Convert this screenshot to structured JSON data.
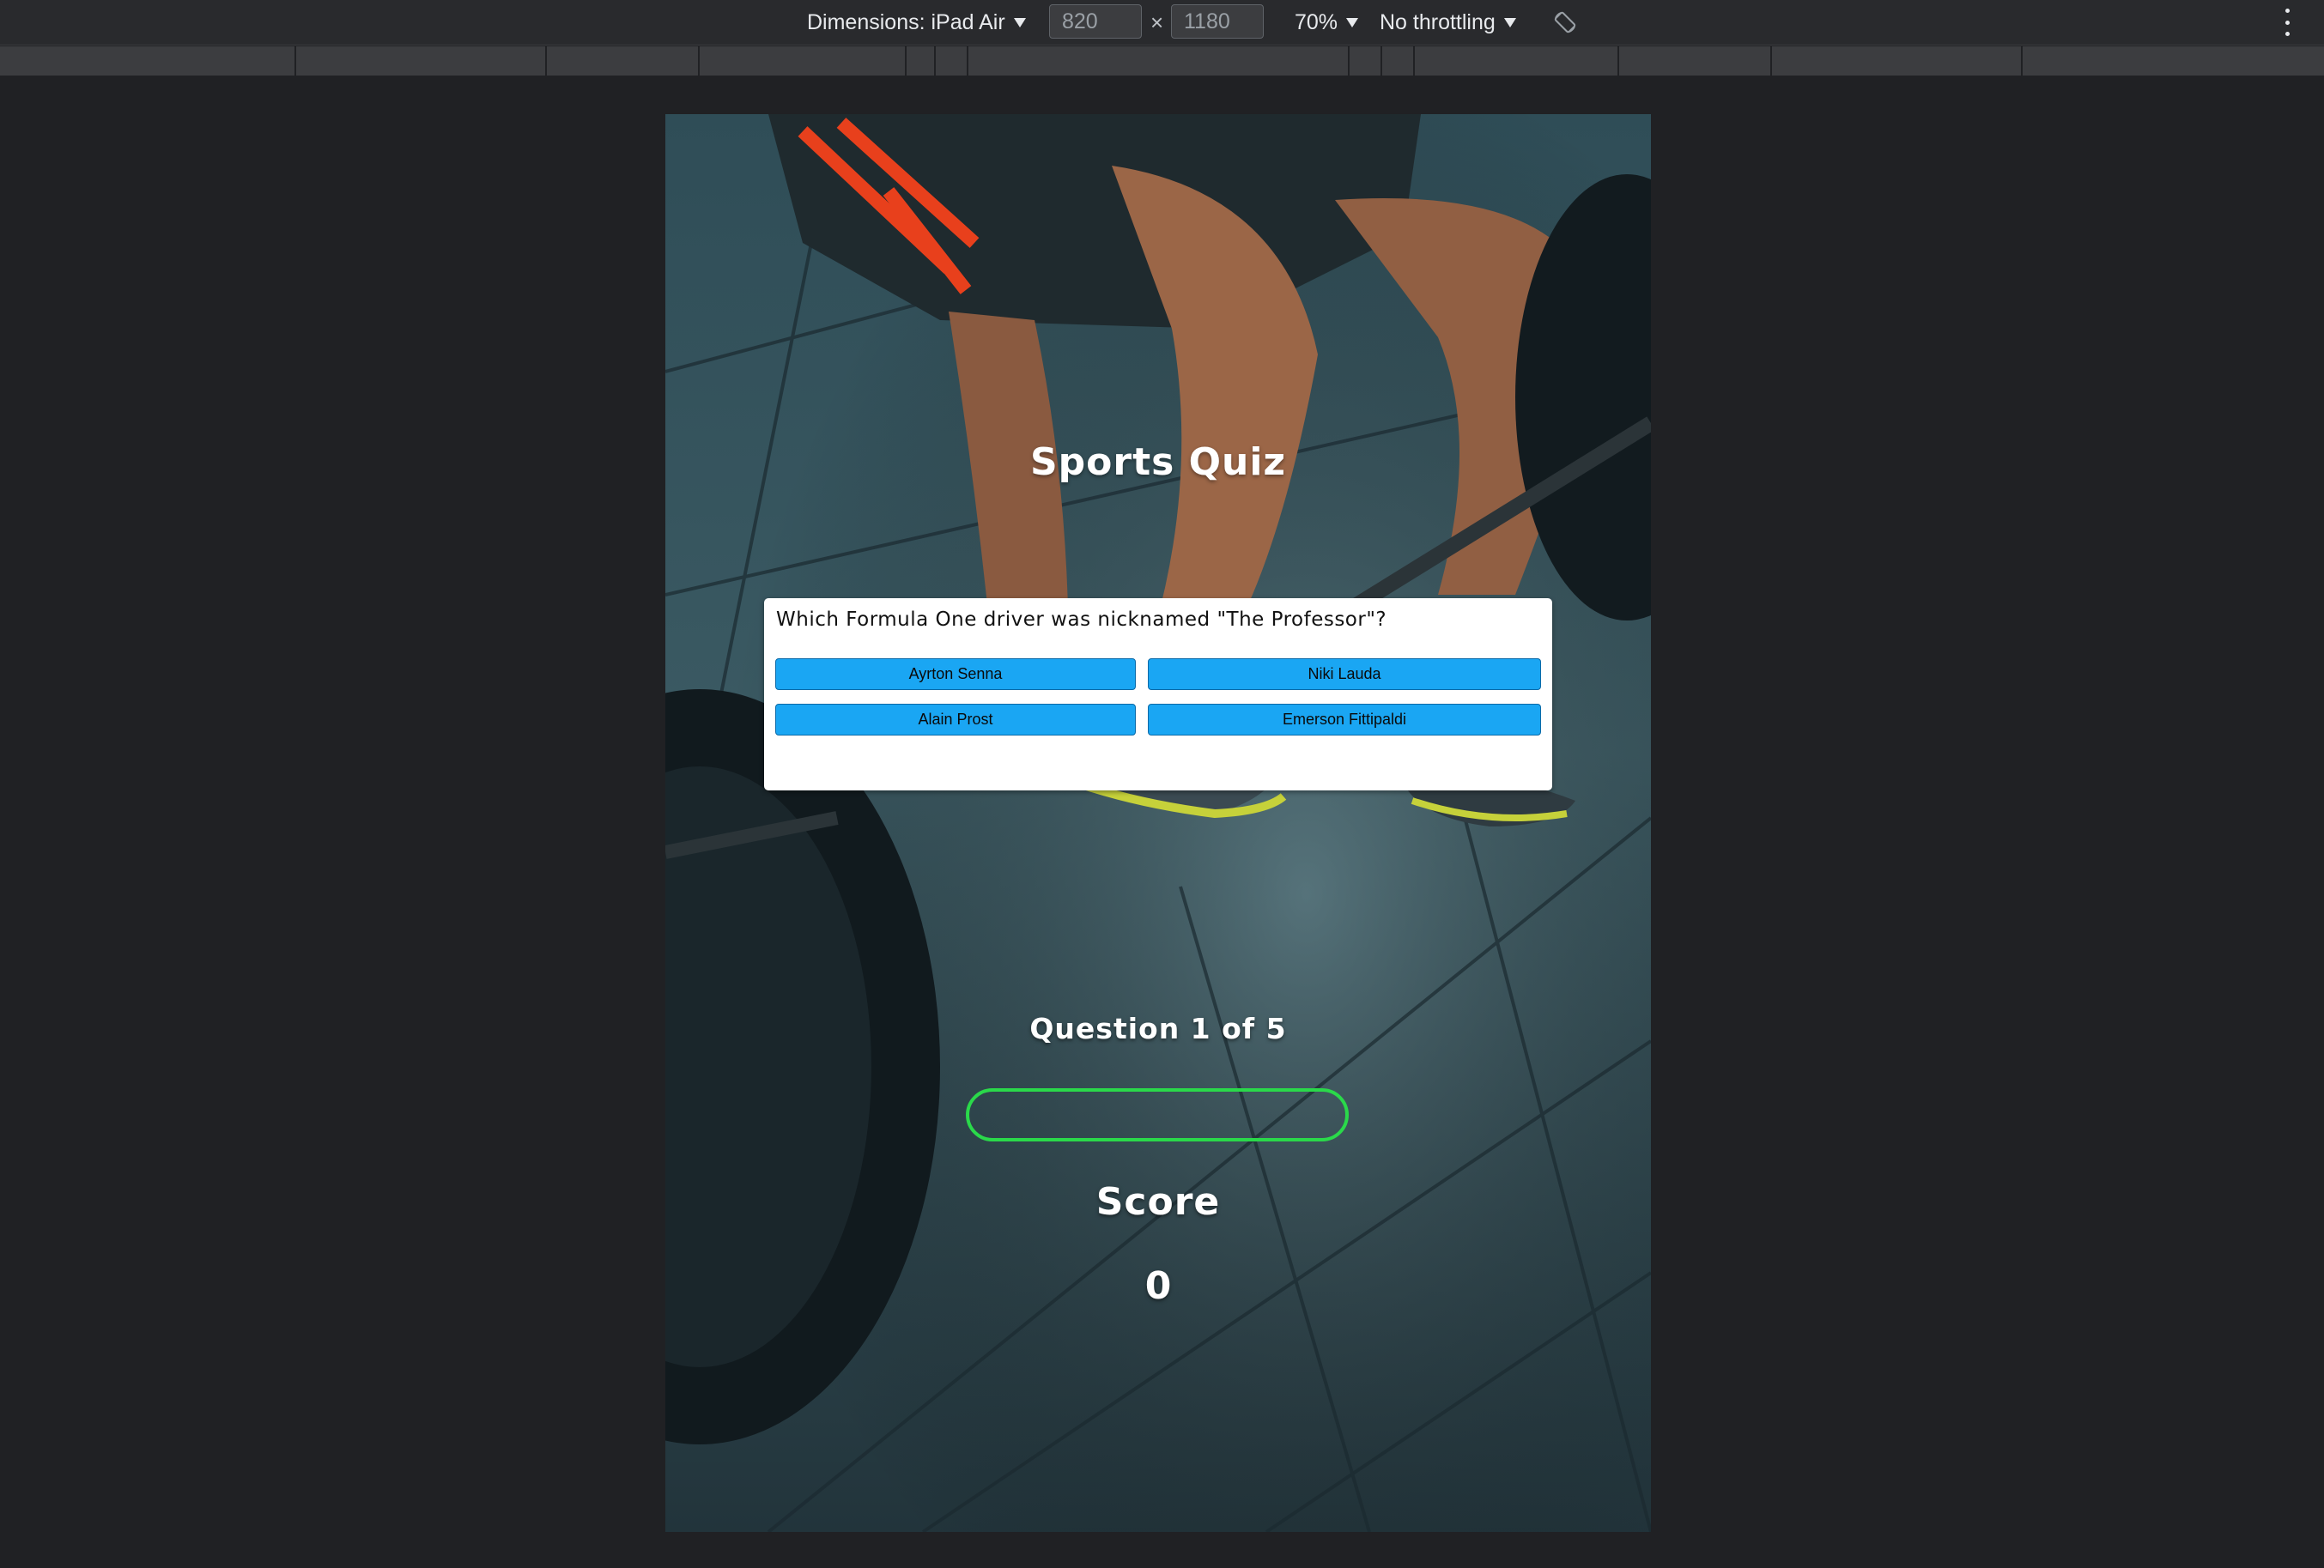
{
  "devtools": {
    "dimensions_label": "Dimensions: iPad Air",
    "width_value": "820",
    "height_value": "1180",
    "times": "×",
    "zoom": "70%",
    "throttling": "No throttling"
  },
  "page": {
    "title": "Sports Quiz",
    "question": "Which Formula One driver was nicknamed \"The Professor\"?",
    "answers": [
      "Ayrton Senna",
      "Niki Lauda",
      "Alain Prost",
      "Emerson Fittipaldi"
    ],
    "progress_text": "Question 1 of 5",
    "progress_fraction": 0,
    "score_label": "Score",
    "score_value": "0"
  },
  "colors": {
    "answer_button": "#1aa6f3",
    "progress_border": "#2ad94a",
    "devtools_bg": "#292a2d",
    "page_bg": "#202124"
  }
}
